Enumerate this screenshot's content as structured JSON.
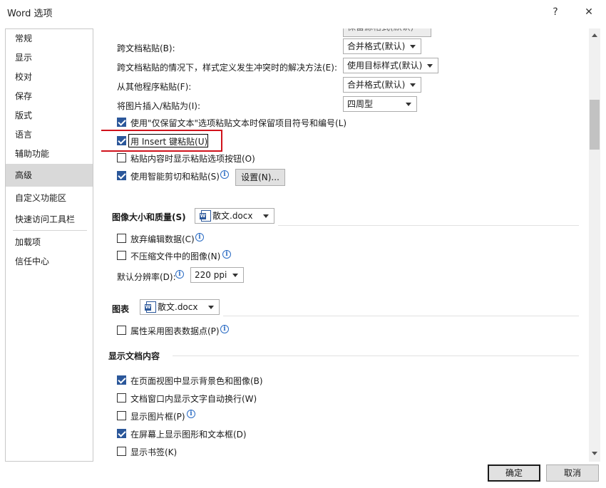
{
  "window": {
    "title": "Word 选项",
    "help_glyph": "?",
    "close_glyph": "✕"
  },
  "sidebar": {
    "items": [
      "常规",
      "显示",
      "校对",
      "保存",
      "版式",
      "语言",
      "辅助功能",
      "高级",
      "自定义功能区",
      "快速访问工具栏",
      "加载项",
      "信任中心"
    ],
    "active": "高级"
  },
  "paste": {
    "partial_value": "保留源格式(默认)",
    "cross_doc_label": "跨文档粘贴(B):",
    "cross_doc_value": "合并格式(默认)",
    "conflict_label": "跨文档粘贴的情况下，样式定义发生冲突时的解决方法(E):",
    "conflict_value": "使用目标样式(默认)",
    "other_prog_label": "从其他程序粘贴(F):",
    "other_prog_value": "合并格式(默认)",
    "image_label": "将图片插入/粘贴为(I):",
    "image_value": "四周型",
    "keep_bullets_label": "使用\"仅保留文本\"选项粘贴文本时保留项目符号和编号(L)",
    "insert_key_label": "用 Insert 键粘贴(U)",
    "show_paste_btn_label": "粘贴内容时显示粘贴选项按钮(O)",
    "smart_cut_label": "使用智能剪切和粘贴(S)",
    "settings_button": "设置(N)..."
  },
  "image_quality": {
    "heading": "图像大小和质量(S)",
    "doc": "散文.docx",
    "discard_label": "放弃编辑数据(C)",
    "no_compress_label": "不压缩文件中的图像(N)",
    "resolution_label": "默认分辨率(D):",
    "resolution_value": "220 ppi"
  },
  "chart": {
    "heading": "图表",
    "doc": "散文.docx",
    "props_label": "属性采用图表数据点(P)"
  },
  "display": {
    "heading": "显示文档内容",
    "bg_label": "在页面视图中显示背景色和图像(B)",
    "wrap_label": "文档窗口内显示文字自动换行(W)",
    "picture_frame_label": "显示图片框(P)",
    "drawings_label": "在屏幕上显示图形和文本框(D)",
    "bookmarks_label": "显示书签(K)"
  },
  "footer": {
    "ok": "确定",
    "cancel": "取消"
  },
  "colors": {
    "accent": "#2b579a",
    "highlight": "#d0121b"
  }
}
